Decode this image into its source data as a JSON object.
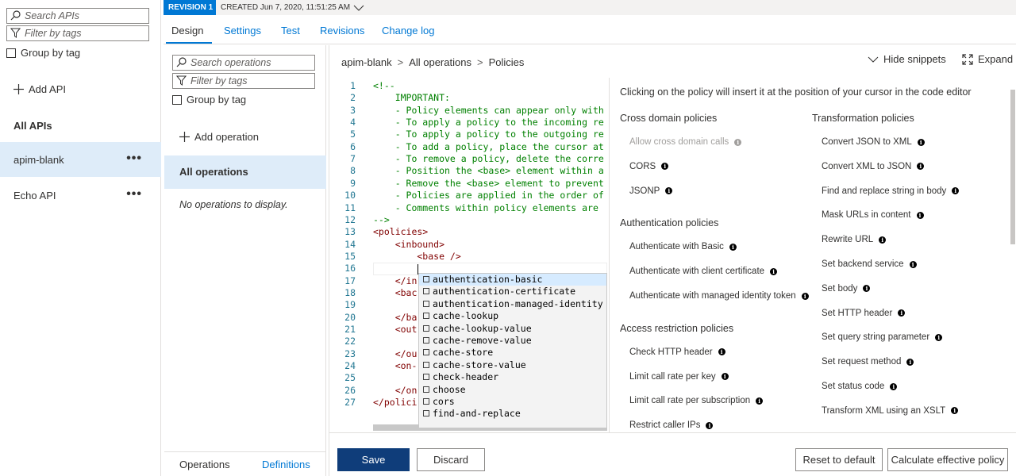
{
  "api_list": {
    "search_placeholder": "Search APIs",
    "filter_placeholder": "Filter by tags",
    "group_by_tag": "Group by tag",
    "add_api": "Add API",
    "all_apis": "All APIs",
    "items": [
      {
        "name": "apim-blank",
        "selected": true
      },
      {
        "name": "Echo API",
        "selected": false
      }
    ],
    "more_label": "•••"
  },
  "revision": {
    "badge": "REVISION 1",
    "created": "CREATED Jun 7, 2020, 11:51:25 AM"
  },
  "tabs": [
    "Design",
    "Settings",
    "Test",
    "Revisions",
    "Change log"
  ],
  "operations": {
    "search_placeholder": "Search operations",
    "filter_placeholder": "Filter by tags",
    "group_by_tag": "Group by tag",
    "add_operation": "Add operation",
    "all_operations": "All operations",
    "empty_text": "No operations to display.",
    "bottom_tabs": [
      "Operations",
      "Definitions"
    ]
  },
  "breadcrumb": [
    "apim-blank",
    "All operations",
    "Policies"
  ],
  "breadcrumb_sep": ">",
  "toolbar": {
    "hide_snippets": "Hide snippets",
    "expand": "Expand"
  },
  "editor": {
    "lines": [
      "<!--",
      "    IMPORTANT:",
      "    - Policy elements can appear only with",
      "    - To apply a policy to the incoming re",
      "    - To apply a policy to the outgoing re",
      "    - To add a policy, place the cursor at",
      "    - To remove a policy, delete the corre",
      "    - Position the <base> element within a",
      "    - Remove the <base> element to prevent",
      "    - Policies are applied in the order of",
      "    - Comments within policy elements are ",
      "-->",
      "<policies>",
      "    <inbound>",
      "        <base />",
      "        ",
      "    </in",
      "    <bac",
      "    ",
      "    </ba",
      "    <out",
      "    ",
      "    </ou",
      "    <on-",
      "    ",
      "    </on",
      "</polici"
    ],
    "autocomplete": [
      "authentication-basic",
      "authentication-certificate",
      "authentication-managed-identity",
      "cache-lookup",
      "cache-lookup-value",
      "cache-remove-value",
      "cache-store",
      "cache-store-value",
      "check-header",
      "choose",
      "cors",
      "find-and-replace"
    ]
  },
  "snippets": {
    "intro": "Clicking on the policy will insert it at the position of your cursor in the code editor",
    "left_groups": [
      {
        "title": "Cross domain policies",
        "items": [
          {
            "label": "Allow cross domain calls",
            "disabled": true
          },
          {
            "label": "CORS",
            "disabled": false
          },
          {
            "label": "JSONP",
            "disabled": false
          }
        ]
      },
      {
        "title": "Authentication policies",
        "items": [
          {
            "label": "Authenticate with Basic",
            "disabled": false
          },
          {
            "label": "Authenticate with client certificate",
            "disabled": false
          },
          {
            "label": "Authenticate with managed identity token",
            "disabled": false
          }
        ]
      },
      {
        "title": "Access restriction policies",
        "items": [
          {
            "label": "Check HTTP header",
            "disabled": false
          },
          {
            "label": "Limit call rate per key",
            "disabled": false
          },
          {
            "label": "Limit call rate per subscription",
            "disabled": false
          },
          {
            "label": "Restrict caller IPs",
            "disabled": false
          }
        ]
      }
    ],
    "right_group": {
      "title": "Transformation policies",
      "items": [
        "Convert JSON to XML",
        "Convert XML to JSON",
        "Find and replace string in body",
        "Mask URLs in content",
        "Rewrite URL",
        "Set backend service",
        "Set body",
        "Set HTTP header",
        "Set query string parameter",
        "Set request method",
        "Set status code",
        "Transform XML using an XSLT"
      ]
    },
    "info_glyph": "i"
  },
  "footer": {
    "save": "Save",
    "discard": "Discard",
    "reset": "Reset to default",
    "calculate": "Calculate effective policy"
  },
  "colors": {
    "accent": "#0078d4",
    "selected_bg": "#deecf9",
    "save_bg": "#0f3d7a"
  }
}
